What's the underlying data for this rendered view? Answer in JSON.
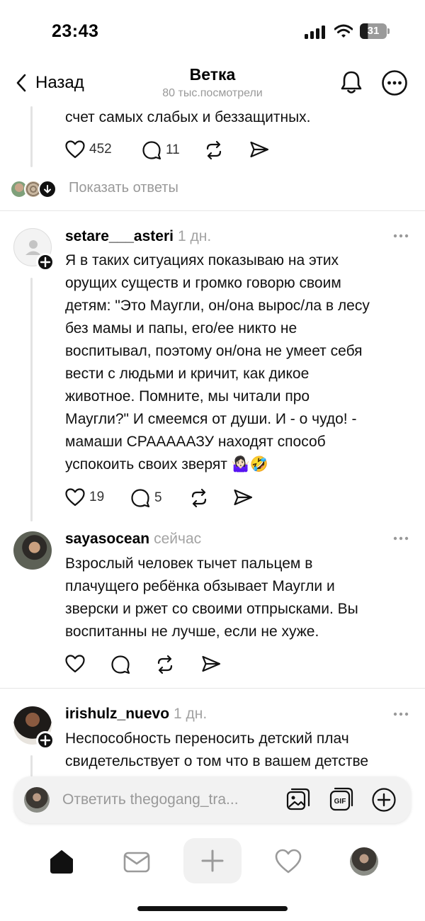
{
  "status_bar": {
    "time": "23:43",
    "battery": "31"
  },
  "header": {
    "back_label": "Назад",
    "title": "Ветка",
    "subtitle": "80 тыс.посмотрели"
  },
  "top_post": {
    "text": "счет самых слабых и беззащитных.",
    "likes": "452",
    "comments": "11"
  },
  "show_replies": {
    "label": "Показать ответы"
  },
  "comments": [
    {
      "username": "setare___asteri",
      "time": "1 дн.",
      "lines": [
        "Я в таких ситуациях показываю на этих",
        "орущих существ и  громко говорю своим",
        "детям: \"Это Маугли, он/она вырос/ла в лесу",
        "без мамы и папы, его/ее никто не",
        "воспитывал, поэтому он/она не умеет себя",
        "вести с людьми и кричит, как дикое",
        "животное. Помните, мы читали про",
        "Маугли?\" И смеемся от души. И - о чудо! -",
        "мамаши СРАААААЗУ находят способ",
        "успокоить своих зверят 🤷🏻‍♀️🤣"
      ],
      "likes": "19",
      "replies": "5"
    },
    {
      "username": "sayasocean",
      "time": "сейчас",
      "lines": [
        "Взрослый человек тычет пальцем в",
        "плачущего ребёнка обзывает Маугли и",
        "зверски и ржет со своими отпрысками. Вы",
        "воспитанны не лучше, если не хуже."
      ]
    },
    {
      "username": "irishulz_nuevo",
      "time": "1 дн.",
      "lines": [
        "Неспособность переносить детский плач",
        "свидетельствует о том что в вашем детстве"
      ]
    }
  ],
  "reply_bar": {
    "placeholder": "Ответить thegogang_tra..."
  },
  "icons": {
    "back": "chevron-left-icon",
    "bell": "bell-icon",
    "more": "more-circle-icon",
    "like": "heart-icon",
    "comment": "speech-bubble-icon",
    "repost": "repost-icon",
    "share": "send-icon",
    "gallery": "gallery-icon",
    "gif": "gif-icon",
    "add": "plus-circle-icon",
    "home": "home-icon",
    "inbox": "mail-icon",
    "create": "plus-icon",
    "activity": "heart-icon",
    "profile": "avatar"
  }
}
